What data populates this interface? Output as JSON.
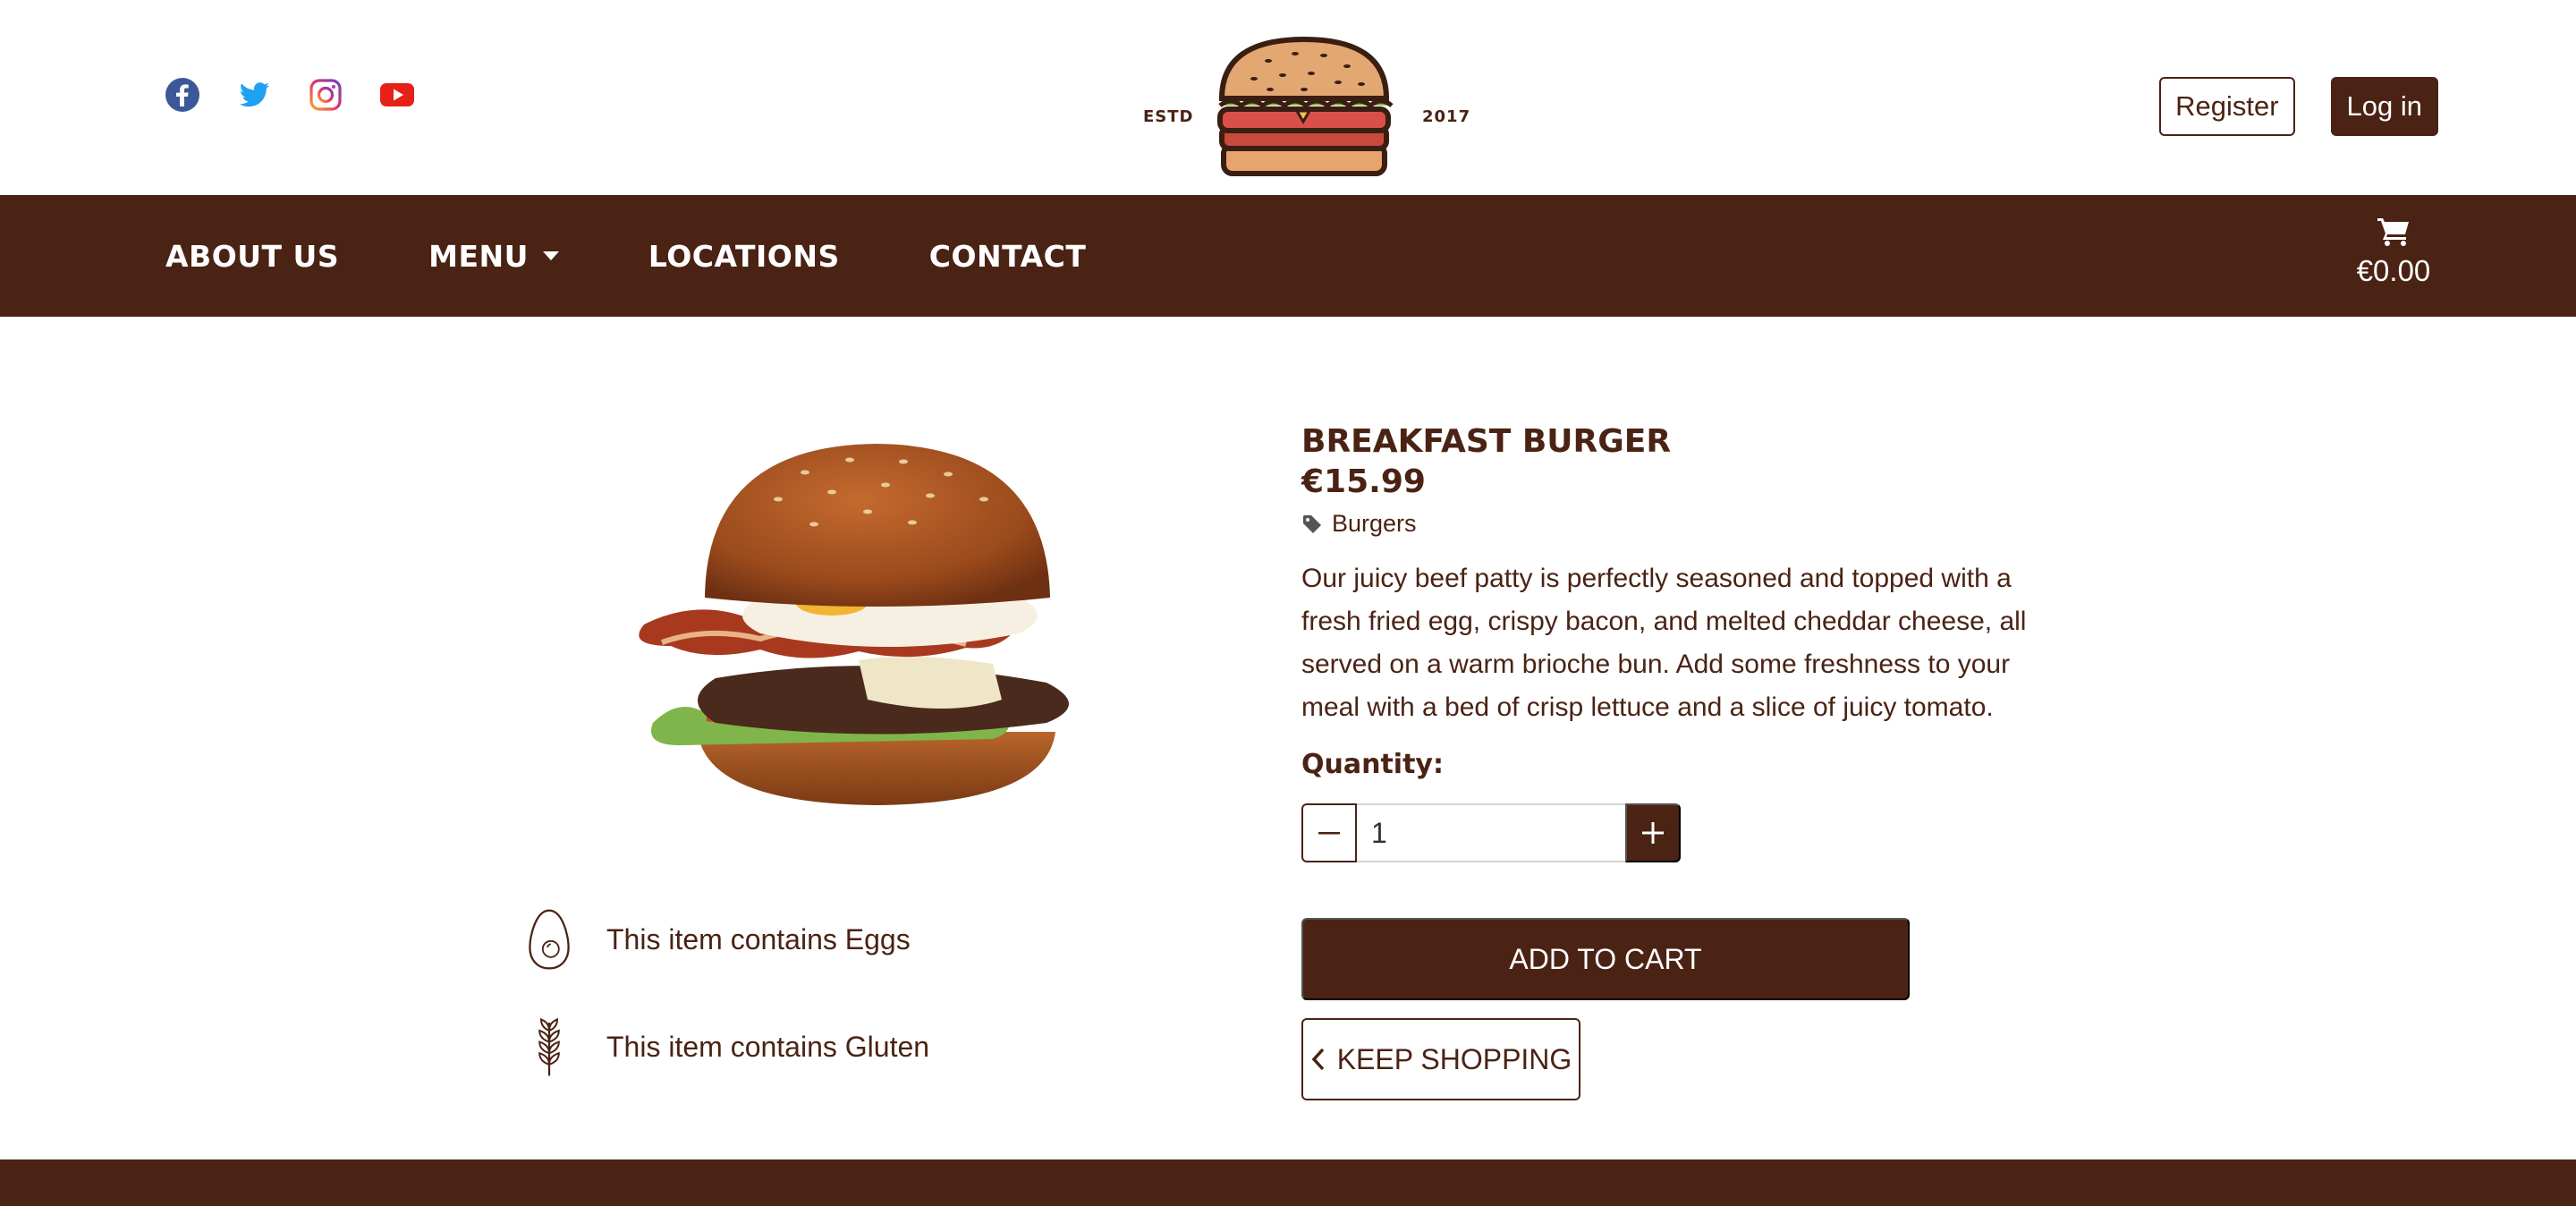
{
  "colors": {
    "brand": "#4a2314",
    "white": "#ffffff",
    "facebook": "#3b5998",
    "twitter": "#1da1f2",
    "youtube": "#e62117"
  },
  "header": {
    "socials": [
      {
        "icon": "facebook-icon"
      },
      {
        "icon": "twitter-icon"
      },
      {
        "icon": "instagram-icon"
      },
      {
        "icon": "youtube-icon"
      }
    ],
    "logo": {
      "estd": "ESTD",
      "year": "2017"
    },
    "register_label": "Register",
    "login_label": "Log in"
  },
  "nav": {
    "items": [
      {
        "label": "ABOUT US"
      },
      {
        "label": "MENU"
      },
      {
        "label": "LOCATIONS"
      },
      {
        "label": "CONTACT"
      }
    ],
    "cart_total": "€0.00"
  },
  "product": {
    "title": "BREAKFAST BURGER",
    "price": "€15.99",
    "category": "Burgers",
    "description": "Our juicy beef patty is perfectly seasoned and topped with a fresh fried egg, crispy bacon, and melted cheddar cheese, all served on a warm brioche bun. Add some freshness to your meal with a bed of crisp lettuce and a slice of juicy tomato.",
    "quantity_label": "Quantity:",
    "quantity": "1",
    "add_to_cart_label": "ADD TO CART",
    "keep_shopping_label": "KEEP SHOPPING",
    "allergens": [
      {
        "text": "This item contains Eggs",
        "icon": "egg-icon"
      },
      {
        "text": "This item contains Gluten",
        "icon": "wheat-icon"
      }
    ]
  }
}
